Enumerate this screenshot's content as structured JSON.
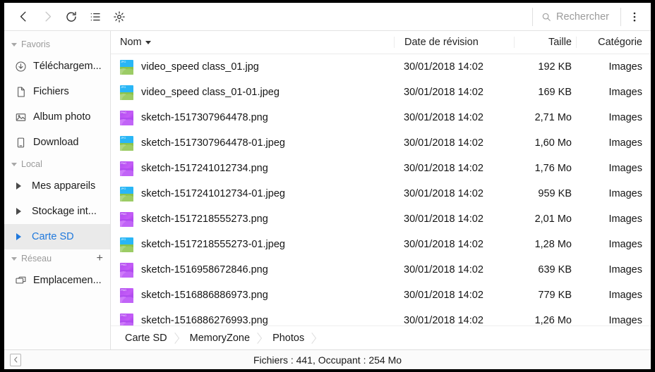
{
  "toolbar": {
    "back_label": "back-arrow",
    "forward_label": "forward-arrow",
    "refresh_label": "refresh",
    "list_view_label": "list-view",
    "settings_label": "settings",
    "overflow_label": "more-options",
    "search_placeholder": "Rechercher"
  },
  "sidebar": {
    "groups": [
      {
        "label": "Favoris",
        "has_add": false,
        "items": [
          {
            "label": "Téléchargem...",
            "icon": "download-circle-icon",
            "selected": false,
            "expandable": false
          },
          {
            "label": "Fichiers",
            "icon": "file-icon",
            "selected": false,
            "expandable": false
          },
          {
            "label": "Album photo",
            "icon": "photo-icon",
            "selected": false,
            "expandable": false
          },
          {
            "label": "Download",
            "icon": "device-icon",
            "selected": false,
            "expandable": false
          }
        ]
      },
      {
        "label": "Local",
        "has_add": false,
        "items": [
          {
            "label": "Mes appareils",
            "icon": "",
            "selected": false,
            "expandable": true
          },
          {
            "label": "Stockage int...",
            "icon": "",
            "selected": false,
            "expandable": true
          },
          {
            "label": "Carte SD",
            "icon": "",
            "selected": true,
            "expandable": true
          }
        ]
      },
      {
        "label": "Réseau",
        "has_add": true,
        "add_label": "+",
        "items": [
          {
            "label": "Emplacemen...",
            "icon": "network-icon",
            "selected": false,
            "expandable": false
          }
        ]
      }
    ]
  },
  "columns": {
    "name": "Nom",
    "date": "Date de révision",
    "size": "Taille",
    "category": "Catégorie",
    "sort_indicator": "descending"
  },
  "files": [
    {
      "name": "video_speed class_01.jpg",
      "date": "30/01/2018 14:02",
      "size": "192 KB",
      "category": "Images",
      "type": "jpg",
      "tag": "JPG"
    },
    {
      "name": "video_speed class_01-01.jpeg",
      "date": "30/01/2018 14:02",
      "size": "169 KB",
      "category": "Images",
      "type": "jpg",
      "tag": "JPG"
    },
    {
      "name": "sketch-1517307964478.png",
      "date": "30/01/2018 14:02",
      "size": "2,71 Mo",
      "category": "Images",
      "type": "png",
      "tag": "PNG"
    },
    {
      "name": "sketch-1517307964478-01.jpeg",
      "date": "30/01/2018 14:02",
      "size": "1,60 Mo",
      "category": "Images",
      "type": "jpg",
      "tag": "JPG"
    },
    {
      "name": "sketch-1517241012734.png",
      "date": "30/01/2018 14:02",
      "size": "1,76 Mo",
      "category": "Images",
      "type": "png",
      "tag": "PNG"
    },
    {
      "name": "sketch-1517241012734-01.jpeg",
      "date": "30/01/2018 14:02",
      "size": "959 KB",
      "category": "Images",
      "type": "jpg",
      "tag": "JPG"
    },
    {
      "name": "sketch-1517218555273.png",
      "date": "30/01/2018 14:02",
      "size": "2,01 Mo",
      "category": "Images",
      "type": "png",
      "tag": "PNG"
    },
    {
      "name": "sketch-1517218555273-01.jpeg",
      "date": "30/01/2018 14:02",
      "size": "1,28 Mo",
      "category": "Images",
      "type": "jpg",
      "tag": "JPG"
    },
    {
      "name": "sketch-1516958672846.png",
      "date": "30/01/2018 14:02",
      "size": "639 KB",
      "category": "Images",
      "type": "png",
      "tag": "PNG"
    },
    {
      "name": "sketch-1516886886973.png",
      "date": "30/01/2018 14:02",
      "size": "779 KB",
      "category": "Images",
      "type": "png",
      "tag": "PNG"
    },
    {
      "name": "sketch-1516886276993.png",
      "date": "30/01/2018 14:02",
      "size": "1,26 Mo",
      "category": "Images",
      "type": "png",
      "tag": "PNG"
    }
  ],
  "breadcrumb": [
    {
      "label": "Carte SD"
    },
    {
      "label": "MemoryZone"
    },
    {
      "label": "Photos"
    }
  ],
  "status": {
    "text": "Fichiers : 441, Occupant : 254 Mo",
    "collapse_label": "‹"
  },
  "colors": {
    "accent": "#1f78dc",
    "selected_bg": "#eaeaea",
    "jpg_thumb": "#29b6f6",
    "png_thumb": "#b14cf0",
    "text": "#151515",
    "muted": "#9a9a9a"
  }
}
